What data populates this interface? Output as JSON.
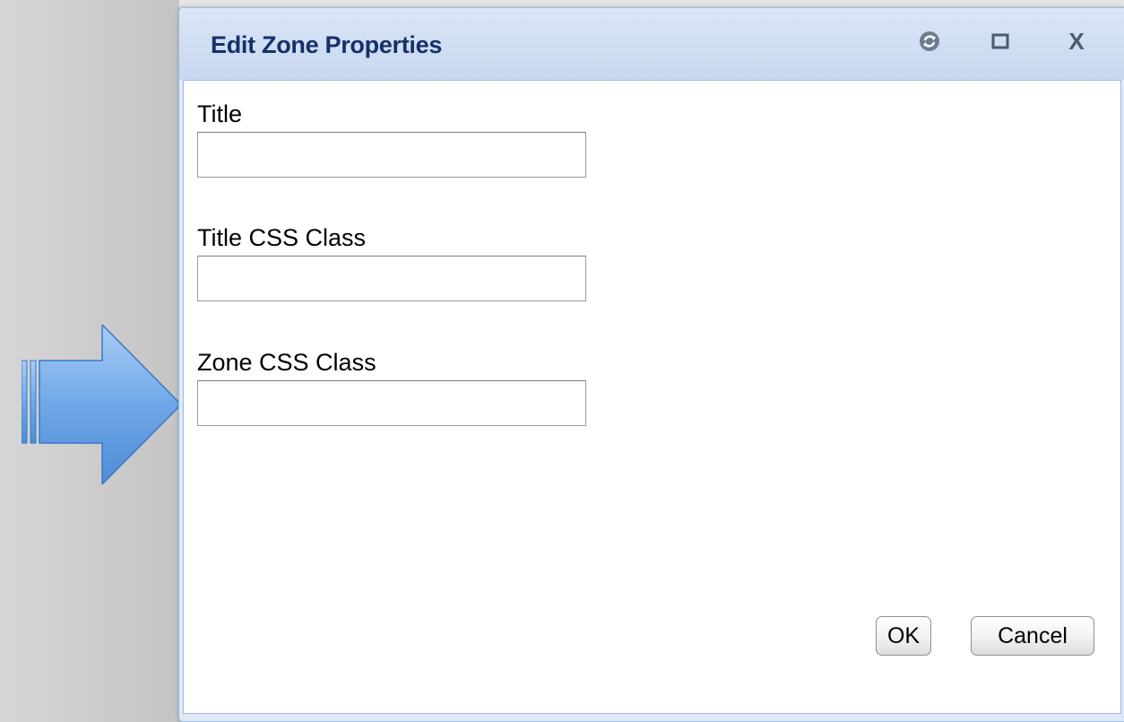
{
  "dialog": {
    "title": "Edit Zone Properties",
    "tools": {
      "refresh_icon": "refresh-icon",
      "maximize_icon": "maximize-icon",
      "close_label": "X"
    }
  },
  "form": {
    "fields": [
      {
        "label": "Title",
        "value": "",
        "placeholder": ""
      },
      {
        "label": "Title CSS Class",
        "value": "",
        "placeholder": ""
      },
      {
        "label": "Zone CSS Class",
        "value": "",
        "placeholder": ""
      }
    ]
  },
  "buttons": {
    "ok_label": "OK",
    "cancel_label": "Cancel"
  },
  "colors": {
    "title_text": "#15316b",
    "titlebar": "#c6d7ef",
    "border": "#99bbe8",
    "arrow": "#5b9be0"
  }
}
